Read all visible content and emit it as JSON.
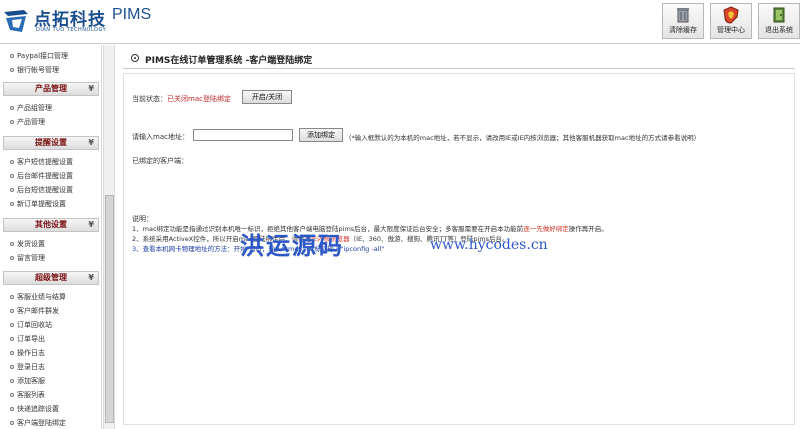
{
  "header": {
    "logo_cn": "点拓科技",
    "logo_en": "PIMS",
    "logo_sub": "DIAN TUO TECHNOLOGY",
    "buttons": {
      "clear_cache": "清除缓存",
      "admin_center": "管理中心",
      "logout": "退出系统"
    }
  },
  "sidebar": {
    "items_top": [
      "Paypal接口管理",
      "银行帐号管理"
    ],
    "sections": [
      {
        "title": "产品管理",
        "items": [
          "产品组管理",
          "产品管理"
        ]
      },
      {
        "title": "提醒设置",
        "items": [
          "客户短信提醒设置",
          "后台邮件提醒设置",
          "后台短信提醒设置",
          "新订单提醒设置"
        ]
      },
      {
        "title": "其他设置",
        "items": [
          "发货设置",
          "留言管理"
        ]
      },
      {
        "title": "超级管理",
        "items": [
          "客服业绩与结算",
          "客户邮件群发",
          "订单回收站",
          "订单导出",
          "操作日志",
          "登录日志",
          "添加客服",
          "客服列表",
          "快递追踪设置",
          "客户端登陆绑定"
        ]
      }
    ],
    "chevron": "¥"
  },
  "main": {
    "title": "PIMS在线订单管理系统 -客户端登陆绑定",
    "status_label": "当前状态：",
    "status_value": "已关闭mac登陆绑定",
    "toggle_button": "开启/关闭",
    "mac_label": "请输入mac地址：",
    "mac_value": "",
    "add_button": "添加绑定",
    "mac_hint": "（*输入框默认的为本机的mac地址，若不显示，请改用IE或IE内核浏览器；其他客服机器获取mac地址的方式请参看说明）",
    "bound_label": "已绑定的客户端：",
    "notes_title": "说明：",
    "note1": "1、mac绑定功能是指通过识别本机唯一标识，拒绝其他客户端电脑登陆pims后台，最大限度保证后台安全；多客服需要在开启本功能前",
    "note1_hl": "逐一先做好绑定",
    "note1_tail": "操作再开启。",
    "note2": "2、系统采用ActiveX控件，所以开启mac登陆绑定后，请使用",
    "note2_hl": "IE内核浏览器",
    "note2_tail": "（IE、360、傲游、搜狗、腾讯TT等）登陆pims后台。",
    "note3": "3、查看本机网卡物理地址的方法：开始-运行，输入\"cmd\"，光标处输入\"ipconfig -all\""
  },
  "watermark": {
    "cn": "洪运源码",
    "en": "www.hycodes.cn"
  },
  "colors": {
    "brand": "#1a4f8f",
    "section_title": "#7a1010",
    "status_red": "#c0282a",
    "note_blue": "#1a3ea6",
    "watermark": "#2c57c7"
  }
}
